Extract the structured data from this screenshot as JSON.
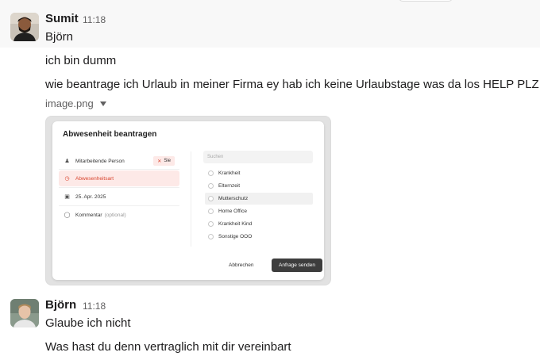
{
  "messages": [
    {
      "sender": "Sumit",
      "time": "11:18",
      "lines": [
        "Björn",
        "ich bin dumm",
        "wie beantrage ich Urlaub in meiner Firma ey hab ich keine Urlaubstage was da los HELP PLZ"
      ],
      "attachment": {
        "file_name": "image.png",
        "dialog": {
          "title": "Abwesenheit beantragen",
          "fields": [
            {
              "icon": "person-icon",
              "label": "Mitarbeitende Person",
              "badge": "Sie"
            },
            {
              "icon": "clock-icon",
              "label": "Abwesenheitsart",
              "active": true
            },
            {
              "icon": "calendar-icon",
              "label": "25. Apr. 2025"
            },
            {
              "icon": "comment-icon",
              "label": "Kommentar",
              "optional": "(optional)"
            }
          ],
          "search_placeholder": "Suchen",
          "options": [
            "Krankheit",
            "Elternzeit",
            "Mutterschutz",
            "Home Office",
            "Krankheit Kind",
            "Sonstige OOO"
          ],
          "highlighted_option": "Mutterschutz",
          "cancel_label": "Abbrechen",
          "submit_label": "Anfrage senden"
        }
      }
    },
    {
      "sender": "Björn",
      "time": "11:18",
      "lines": [
        "Glaube ich nicht",
        "Was hast du denn vertraglich mit dir vereinbart"
      ]
    }
  ],
  "colors": {
    "hover_bg": "#f8f8f8",
    "text": "#1d1c1d",
    "muted": "#616061",
    "accent_red": "#d9452f",
    "submit_bg": "#3d3d3d"
  }
}
